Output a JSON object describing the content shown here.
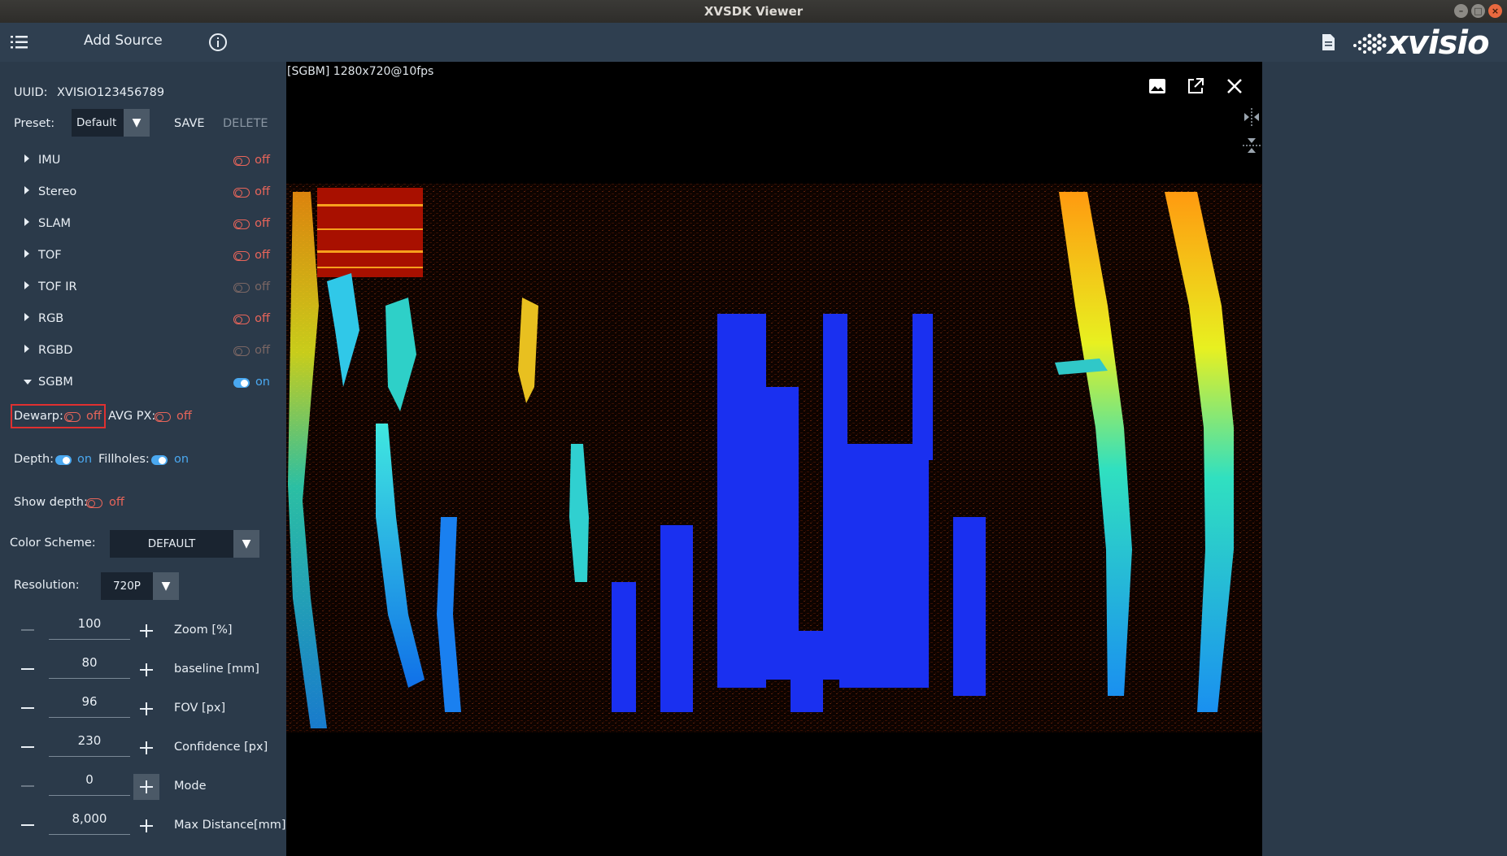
{
  "window": {
    "title": "XVSDK Viewer"
  },
  "appbar": {
    "add_source": "Add Source",
    "logo": "xvisio"
  },
  "sidebar": {
    "uuid_label": "UUID:",
    "uuid_value": "XVISIO123456789",
    "preset_label": "Preset:",
    "preset_value": "Default",
    "save": "SAVE",
    "delete": "DELETE",
    "items": [
      {
        "name": "IMU",
        "state": "off",
        "enabled": true
      },
      {
        "name": "Stereo",
        "state": "off",
        "enabled": true
      },
      {
        "name": "SLAM",
        "state": "off",
        "enabled": true
      },
      {
        "name": "TOF",
        "state": "off",
        "enabled": true
      },
      {
        "name": "TOF IR",
        "state": "off",
        "enabled": false
      },
      {
        "name": "RGB",
        "state": "off",
        "enabled": true
      },
      {
        "name": "RGBD",
        "state": "off",
        "enabled": false
      },
      {
        "name": "SGBM",
        "state": "on",
        "enabled": true
      }
    ],
    "dewarp_label": "Dewarp:",
    "dewarp_state": "off",
    "avgpx_label": "AVG PX:",
    "avgpx_state": "off",
    "depth_label": "Depth:",
    "depth_state": "on",
    "fillholes_label": "Fillholes:",
    "fillholes_state": "on",
    "showdepth_label": "Show depth:",
    "showdepth_state": "off",
    "colorscheme_label": "Color Scheme:",
    "colorscheme_value": "DEFAULT",
    "resolution_label": "Resolution:",
    "resolution_value": "720P",
    "steppers": [
      {
        "value": "100",
        "label": "Zoom [%]"
      },
      {
        "value": "80",
        "label": "baseline [mm]"
      },
      {
        "value": "96",
        "label": "FOV [px]"
      },
      {
        "value": "230",
        "label": "Confidence [px]"
      },
      {
        "value": "0",
        "label": "Mode"
      },
      {
        "value": "8,000",
        "label": "Max Distance[mm]"
      }
    ]
  },
  "view": {
    "stream_label": "[SGBM]  1280x720@10fps"
  },
  "colors": {
    "accent_on": "#4aa8f0",
    "state_off": "#e8655a",
    "panel": "#2b3a4a"
  }
}
